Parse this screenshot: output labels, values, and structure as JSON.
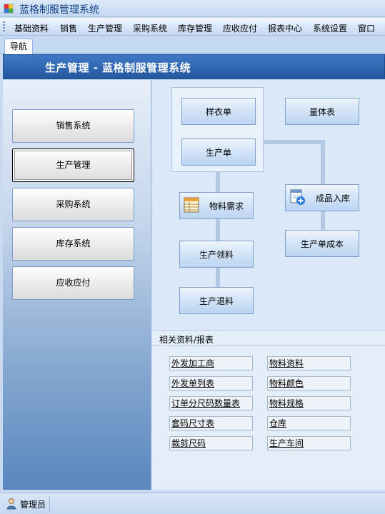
{
  "window": {
    "title": "蓝格制服管理系统"
  },
  "menu": {
    "items": [
      "基础资料",
      "销售",
      "生产管理",
      "采购系统",
      "库存管理",
      "应收应付",
      "报表中心",
      "系统设置",
      "窗口"
    ]
  },
  "tab": {
    "label": "导航"
  },
  "header": {
    "title": "生产管理 - 蓝格制服管理系统"
  },
  "nav": {
    "buttons": [
      "销售系统",
      "生产管理",
      "采购系统",
      "库存系统",
      "应收应付"
    ],
    "active_index": 1
  },
  "flow": {
    "sample_order": "样衣单",
    "measure_sheet": "量体表",
    "production_order": "生产单",
    "material_demand": "物料需求",
    "finished_goods_in": "成品入库",
    "production_cost": "生产单成本",
    "production_picking": "生产领料",
    "production_return": "生产退料"
  },
  "related": {
    "title": "相关资料/报表",
    "left": [
      "外发加工商",
      "外发单列表",
      "订单分尺码数量表",
      "套码尺寸表",
      "裁剪尺码"
    ],
    "right": [
      "物料资料",
      "物料颜色",
      "物料规格",
      "仓库",
      "生产车间"
    ]
  },
  "status": {
    "user": "管理员"
  },
  "icons": {
    "app": "app-icon",
    "material_demand": "grid-form-icon",
    "finished_goods_in": "add-document-icon",
    "user": "user-icon"
  },
  "colors": {
    "header": "#2d64ad",
    "menu_text": "#000000",
    "title_text": "#15428b"
  }
}
